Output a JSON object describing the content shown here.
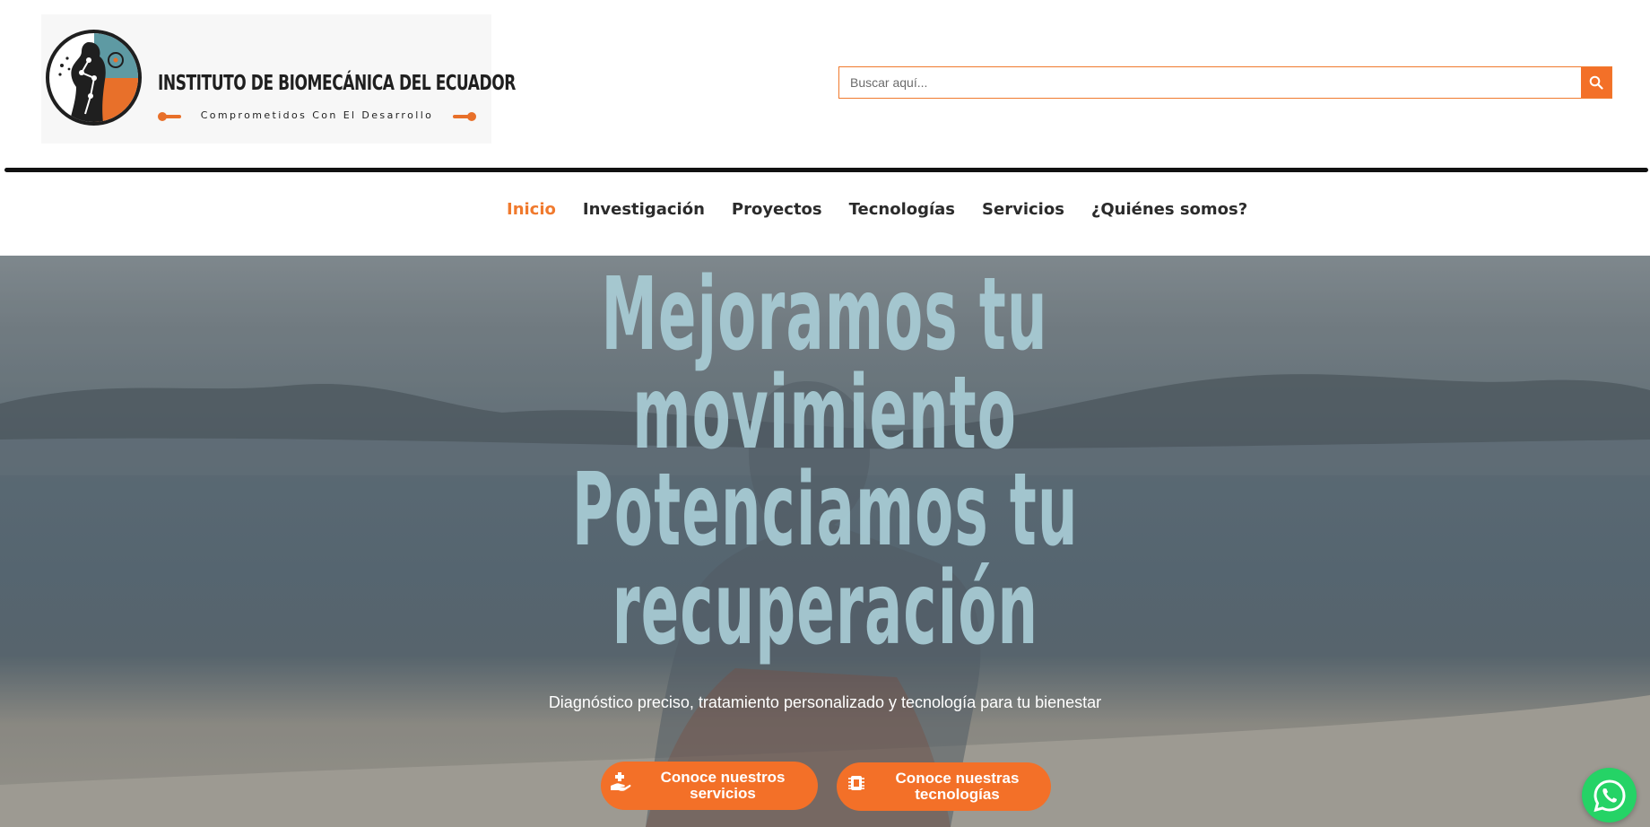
{
  "brand": {
    "name": "INSTITUTO DE BIOMECÁNICA DEL ECUADOR",
    "tagline": "Comprometidos Con El Desarrollo",
    "accent_color": "#f07a2e"
  },
  "search": {
    "placeholder": "Buscar aquí...",
    "button_icon": "search-icon"
  },
  "nav": {
    "items": [
      {
        "label": "Inicio",
        "active": true
      },
      {
        "label": "Investigación",
        "active": false
      },
      {
        "label": "Proyectos",
        "active": false
      },
      {
        "label": "Tecnologías",
        "active": false
      },
      {
        "label": "Servicios",
        "active": false
      },
      {
        "label": "¿Quiénes somos?",
        "active": false
      }
    ]
  },
  "hero": {
    "headline_lines": [
      "Mejoramos tu",
      "movimiento",
      "Potenciamos tu",
      "recuperación"
    ],
    "subtitle": "Diagnóstico preciso, tratamiento personalizado y tecnología para tu bienestar",
    "buttons": [
      {
        "label": "Conoce nuestros servicios",
        "icon": "hand-medical-icon"
      },
      {
        "label": "Conoce nuestras tecnologías",
        "icon": "microchip-icon"
      }
    ]
  },
  "floating": {
    "whatsapp_icon": "whatsapp-icon",
    "color": "#25d366"
  }
}
